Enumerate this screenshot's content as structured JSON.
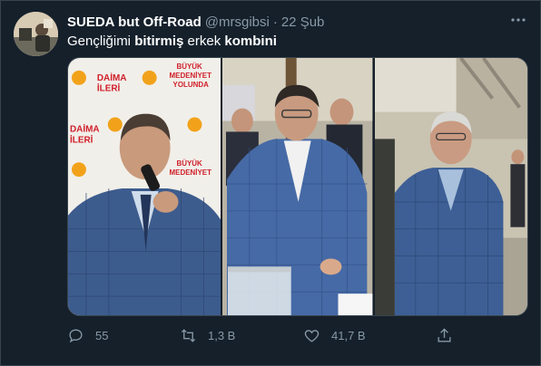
{
  "tweet": {
    "display_name": "SUEDA but Off-Road",
    "handle": "@mrsgibsi",
    "separator": "·",
    "date": "22 Şub",
    "text_parts": {
      "p1": "Gençliğimi ",
      "p2": "bitirmiş",
      "p3": " erkek ",
      "p4": "kombini"
    },
    "more_icon": "ellipsis-icon"
  },
  "media": {
    "photos": [
      {
        "name": "photo-left"
      },
      {
        "name": "photo-middle"
      },
      {
        "name": "photo-right"
      }
    ],
    "banner_text": {
      "line_a": "DAİMA",
      "line_b": "İLERİ",
      "line_c": "BÜYÜK",
      "line_d": "MEDENİYET",
      "line_e": "YOLUNDA"
    }
  },
  "actions": {
    "reply": {
      "count": "55",
      "icon": "reply-icon"
    },
    "retweet": {
      "count": "1,3 B",
      "icon": "retweet-icon"
    },
    "like": {
      "count": "41,7 B",
      "icon": "heart-icon"
    },
    "share": {
      "icon": "share-icon"
    }
  },
  "colors": {
    "background": "#15202b",
    "border": "#38444d",
    "secondary_text": "#8899a6",
    "primary_text": "#ffffff"
  }
}
